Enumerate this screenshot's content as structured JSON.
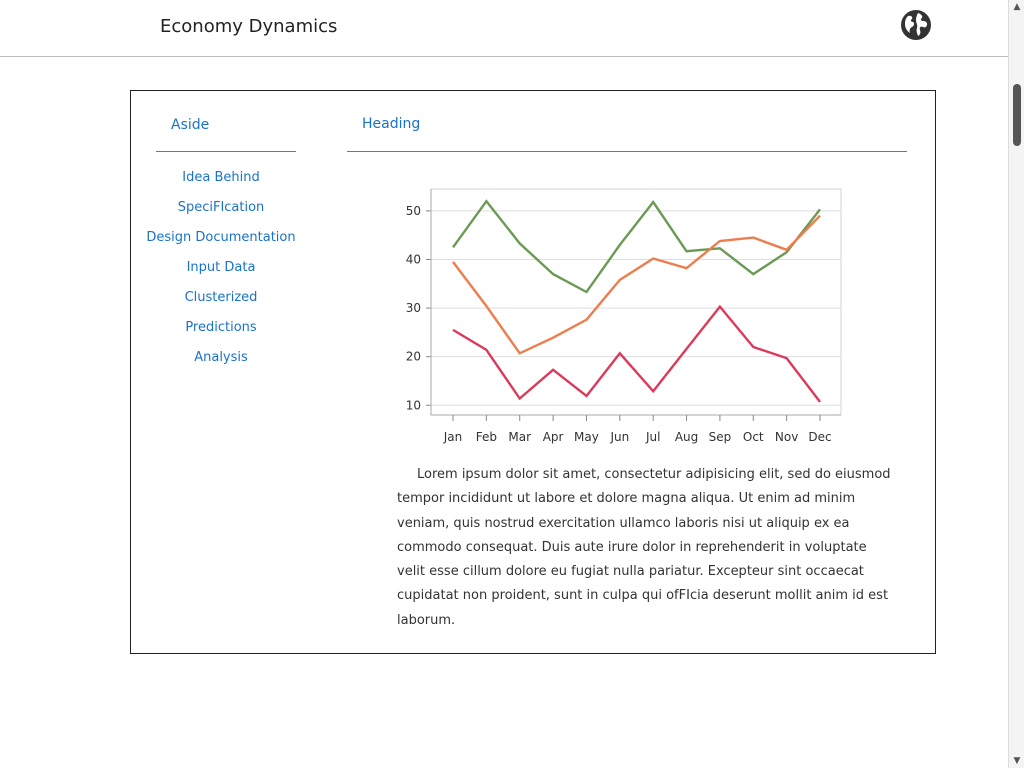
{
  "header": {
    "title": "Economy Dynamics",
    "globe_icon": "globe-icon"
  },
  "aside": {
    "title": "Aside",
    "items": [
      {
        "label": "Idea Behind"
      },
      {
        "label": "SpeciFIcation"
      },
      {
        "label": "Design Documentation"
      },
      {
        "label": "Input Data"
      },
      {
        "label": "Clusterized"
      },
      {
        "label": "Predictions"
      },
      {
        "label": "Analysis"
      }
    ]
  },
  "main": {
    "heading": "Heading",
    "paragraph": "Lorem ipsum dolor sit amet, consectetur adipisicing elit, sed do eiusmod tempor incididunt ut labore et dolore magna aliqua. Ut enim ad minim veniam, quis nostrud exercitation ullamco laboris nisi ut aliquip ex ea commodo consequat. Duis aute irure dolor in reprehenderit in voluptate velit esse cillum dolore eu fugiat nulla pariatur. Excepteur sint occaecat cupidatat non proident, sunt in culpa qui ofFIcia deserunt mollit anim id est laborum."
  },
  "colors": {
    "link": "#1a73c8",
    "series_green": "#6b9a55",
    "series_orange": "#ee7d4e",
    "series_red": "#dd3a5b"
  },
  "chart_data": {
    "type": "line",
    "categories": [
      "Jan",
      "Feb",
      "Mar",
      "Apr",
      "May",
      "Jun",
      "Jul",
      "Aug",
      "Sep",
      "Oct",
      "Nov",
      "Dec"
    ],
    "series": [
      {
        "color": "#6b9a55",
        "values": [
          42.5,
          52,
          43.3,
          37,
          33.3,
          43,
          51.8,
          41.7,
          42.3,
          37,
          41.5,
          50.3
        ]
      },
      {
        "color": "#ee7d4e",
        "values": [
          39.5,
          30.4,
          20.7,
          23.9,
          27.6,
          35.8,
          40.2,
          38.2,
          43.8,
          44.5,
          42,
          49
        ]
      },
      {
        "color": "#dd3a5b",
        "values": [
          25.5,
          21.4,
          11.4,
          17.3,
          11.9,
          20.7,
          12.9,
          21.6,
          30.3,
          22,
          19.7,
          10.7
        ]
      }
    ],
    "yticks": [
      10,
      20,
      30,
      40,
      50
    ],
    "ylim": [
      8,
      54.5
    ],
    "grid": true,
    "title": "",
    "xlabel": "",
    "ylabel": ""
  }
}
